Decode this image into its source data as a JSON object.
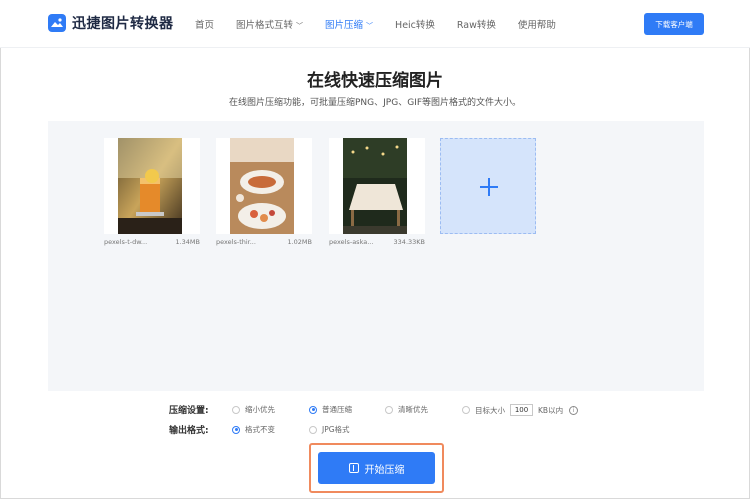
{
  "header": {
    "logo_text": "迅捷图片转换器",
    "nav": [
      {
        "label": "首页",
        "chevron": ""
      },
      {
        "label": "图片格式互转",
        "chevron": "﹀"
      },
      {
        "label": "图片压缩",
        "chevron": "﹀",
        "active": true
      },
      {
        "label": "Heic转换",
        "chevron": ""
      },
      {
        "label": "Raw转换",
        "chevron": ""
      },
      {
        "label": "使用帮助",
        "chevron": ""
      }
    ],
    "download_label": "下载客户端"
  },
  "page": {
    "title": "在线快速压缩图片",
    "subtitle": "在线图片压缩功能，可批量压缩PNG、JPG、GIF等图片格式的文件大小。"
  },
  "files": [
    {
      "name": "pexels-t-dw...",
      "size": "1.34MB"
    },
    {
      "name": "pexels-thir...",
      "size": "1.02MB"
    },
    {
      "name": "pexels-aska...",
      "size": "334.33KB"
    }
  ],
  "settings": {
    "compress_label": "压缩设置:",
    "compress_options": [
      "缩小优先",
      "普通压缩",
      "清晰优先",
      "目标大小"
    ],
    "target_value": "100",
    "target_unit": "KB以内",
    "info_icon_glyph": "i",
    "output_label": "输出格式:",
    "output_options": [
      "格式不变",
      "JPG格式"
    ]
  },
  "start_label": "开始压缩",
  "colors": {
    "accent": "#2f7bf6",
    "highlight": "#f08a5d"
  }
}
